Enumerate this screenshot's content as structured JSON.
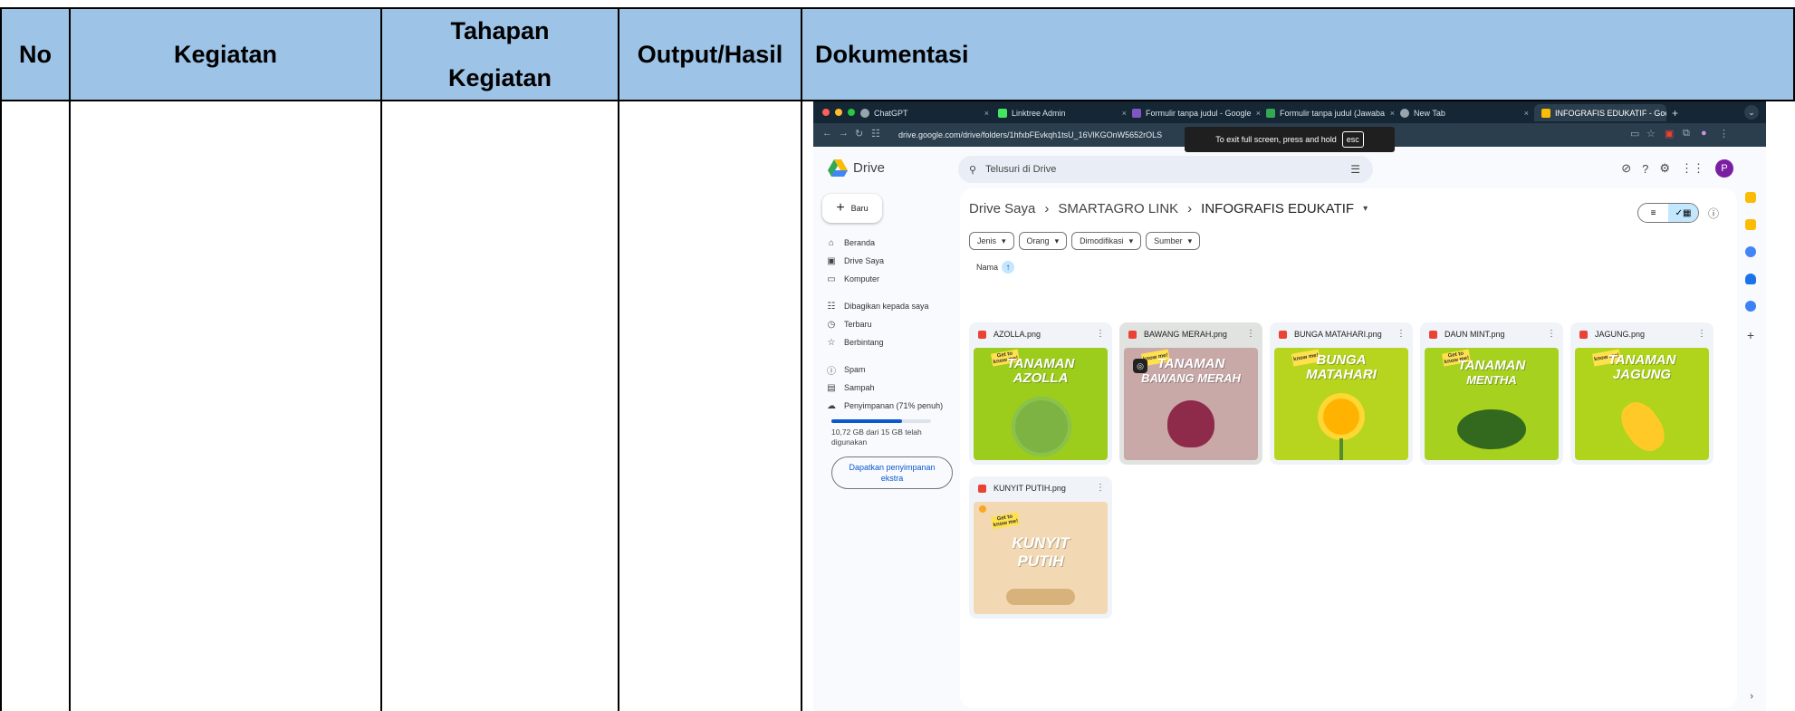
{
  "table": {
    "headers": {
      "no": "No",
      "kegiatan": "Kegiatan",
      "tahapan_line1": "Tahapan",
      "tahapan_line2": "Kegiatan",
      "output": "Output/Hasil",
      "dokumentasi": "Dokumentasi"
    },
    "header_color": "#9dc3e6"
  },
  "browser": {
    "tabs": [
      {
        "label": "ChatGPT",
        "color": "#9aa4ab"
      },
      {
        "label": "Linktree Admin",
        "color": "#43e660"
      },
      {
        "label": "Formulir tanpa judul - Google",
        "color": "#7e57c2"
      },
      {
        "label": "Formulir tanpa judul (Jawaba",
        "color": "#34a853"
      },
      {
        "label": "New Tab",
        "color": "#9aa4ab"
      },
      {
        "label": "INFOGRAFIS EDUKATIF - Goo",
        "color": "#fbbc04"
      }
    ],
    "tab_close": "×",
    "new_tab": "+",
    "url": "drive.google.com/drive/folders/1hfxbFEvkqh1tsU_16VlKGOnW5652rOLS",
    "fullscreen_note": "To exit full screen, press and hold",
    "esc_key": "esc"
  },
  "drive": {
    "logo_text": "Drive",
    "search_placeholder": "Telusuri di Drive",
    "avatar_letter": "P",
    "new_button": "Baru",
    "nav": [
      {
        "label": "Beranda",
        "icon": "home-icon",
        "glyph": "⌂"
      },
      {
        "label": "Drive Saya",
        "icon": "drive-icon",
        "glyph": "▣"
      },
      {
        "label": "Komputer",
        "icon": "computer-icon",
        "glyph": "▭"
      },
      {
        "label": "Dibagikan kepada saya",
        "icon": "shared-icon",
        "glyph": "☷"
      },
      {
        "label": "Terbaru",
        "icon": "clock-icon",
        "glyph": "◷"
      },
      {
        "label": "Berbintang",
        "icon": "star-icon",
        "glyph": "☆"
      },
      {
        "label": "Spam",
        "icon": "spam-icon",
        "glyph": "ⓘ"
      },
      {
        "label": "Sampah",
        "icon": "trash-icon",
        "glyph": "▤"
      },
      {
        "label": "Penyimpanan (71% penuh)",
        "icon": "cloud-icon",
        "glyph": "☁"
      }
    ],
    "storage_percent": 71,
    "storage_text": "10,72 GB dari 15 GB telah digunakan",
    "get_storage": "Dapatkan penyimpanan ekstra",
    "breadcrumb": {
      "root": "Drive Saya",
      "sep1": "›",
      "mid": "SMARTAGRO LINK",
      "sep2": "›",
      "current": "INFOGRAFIS EDUKATIF",
      "caret": "▾"
    },
    "filters": [
      "Jenis",
      "Orang",
      "Dimodifikasi",
      "Sumber"
    ],
    "sort_label": "Nama",
    "files": [
      {
        "name": "AZOLLA.png",
        "title1": "TANAMAN",
        "title2": "AZOLLA",
        "bg": "#9ccc1c",
        "tag": "Get to know me!"
      },
      {
        "name": "BAWANG MERAH.png",
        "title1": "TANAMAN",
        "title2": "BAWANG MERAH",
        "bg": "#c9a8a8",
        "tag": "know me!"
      },
      {
        "name": "BUNGA MATAHARI.png",
        "title1": "BUNGA",
        "title2": "MATAHARI",
        "bg": "#b7d51e",
        "tag": "know me!"
      },
      {
        "name": "DAUN MINT.png",
        "title1": "TANAMAN",
        "title2": "MENTHA",
        "bg": "#a6d11f",
        "tag": "Get to know me!"
      },
      {
        "name": "JAGUNG.png",
        "title1": "TANAMAN",
        "title2": "JAGUNG",
        "bg": "#b0d41c",
        "tag": "know me!"
      },
      {
        "name": "KUNYIT PUTIH.png",
        "title1": "KUNYIT",
        "title2": "PUTIH",
        "bg": "#f2d9b3",
        "tag": "Get to know me!"
      }
    ]
  }
}
